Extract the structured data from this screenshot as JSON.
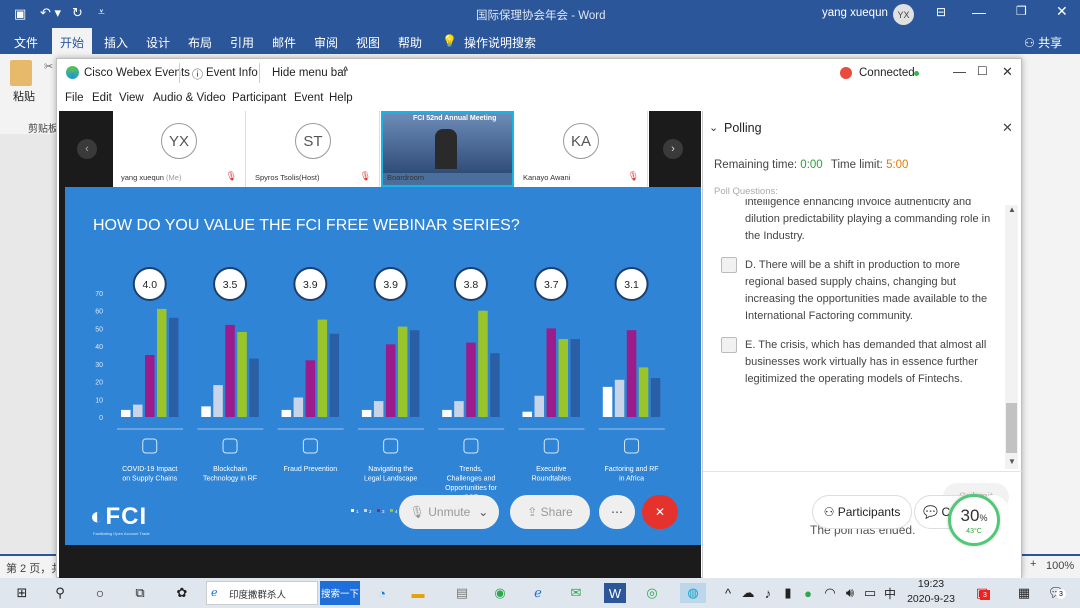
{
  "word": {
    "title": "国际保理协会年会 - Word",
    "user": "yang xuequn",
    "user_initials": "YX",
    "share": "共享",
    "ribbon_tabs": [
      "文件",
      "开始",
      "插入",
      "设计",
      "布局",
      "引用",
      "邮件",
      "审阅",
      "视图",
      "帮助"
    ],
    "tell_me": "操作说明搜索",
    "paste": "粘贴",
    "clipboard": "剪贴板",
    "status_left": "第 2 页，共",
    "zoom": "100%"
  },
  "webex": {
    "app": "Cisco Webex Events",
    "event_info": "Event Info",
    "hide_menu": "Hide menu bar",
    "connected": "Connected",
    "menu": [
      "File",
      "Edit",
      "View",
      "Audio & Video",
      "Participant",
      "Event",
      "Help"
    ],
    "participants": [
      {
        "initials": "YX",
        "name": "yang xuequn",
        "role": "(Me)"
      },
      {
        "initials": "ST",
        "name": "Spyros Tsolis",
        "role": "(Host)"
      },
      {
        "initials": "",
        "name": "Boardroom",
        "role": ""
      },
      {
        "initials": "KA",
        "name": "Kanayo Awani",
        "role": ""
      }
    ],
    "video_banner": "FCI 52nd Annual Meeting",
    "controls": {
      "unmute": "Unmute",
      "share": "Share",
      "participants": "Participants",
      "chat": "Chat"
    }
  },
  "slide": {
    "logo": "FCI",
    "logo_tagline": "Facilitating Open Account Trade"
  },
  "poll": {
    "title": "Polling",
    "remaining_label": "Remaining time:",
    "remaining": "0:00",
    "limit_label": "Time limit:",
    "limit": "5:00",
    "questions_label": "Poll Questions:",
    "continuation": "intelligence enhancing invoice authenticity and dilution predictability playing a commanding role in the Industry.",
    "options": [
      {
        "text": "D.  There will be a shift in production to more regional based supply chains, changing but increasing the opportunities made available to the International Factoring community."
      },
      {
        "text": "E.  The crisis, which has demanded that almost all businesses work virtually has in essence further legitimized the operating models of Fintechs."
      }
    ],
    "submit": "Submit",
    "ended": "The poll has ended."
  },
  "perf": {
    "value": "30",
    "unit": "%",
    "temp": "43°C"
  },
  "taskbar": {
    "search": "印度撒群杀人",
    "search_btn": "搜索一下",
    "time": "19:23",
    "date": "2020-9-23",
    "ime": "中",
    "badge": "3"
  },
  "colors": {
    "series": [
      "#ffffff",
      "#c9d4e8",
      "#9b1c8a",
      "#9ac52a",
      "#2a5fa6"
    ]
  },
  "chart_data": {
    "type": "bar",
    "title": "HOW DO YOU VALUE THE FCI FREE WEBINAR SERIES?",
    "categories": [
      "COVID-19 Impact on Supply Chains",
      "Blockchain Technology in RF",
      "Fraud Prevention",
      "Navigating the Legal Landscape",
      "Trends, Challenges and Opportunities for SCF",
      "Executive Roundtables",
      "Factoring and RF in Africa"
    ],
    "averages": [
      "4.0",
      "3.5",
      "3.9",
      "3.9",
      "3.8",
      "3.7",
      "3.1"
    ],
    "ylim": [
      0,
      70
    ],
    "yticks": [
      "0",
      "10",
      "20",
      "30",
      "40",
      "50",
      "60",
      "70"
    ],
    "series": [
      {
        "name": "1",
        "values": [
          4,
          6,
          4,
          4,
          4,
          3,
          17
        ]
      },
      {
        "name": "2",
        "values": [
          7,
          18,
          11,
          9,
          9,
          12,
          21
        ]
      },
      {
        "name": "3",
        "values": [
          35,
          52,
          32,
          41,
          42,
          50,
          49
        ]
      },
      {
        "name": "4",
        "values": [
          61,
          48,
          55,
          51,
          60,
          44,
          28
        ]
      },
      {
        "name": "5",
        "values": [
          56,
          33,
          47,
          49,
          36,
          44,
          22
        ]
      }
    ]
  }
}
